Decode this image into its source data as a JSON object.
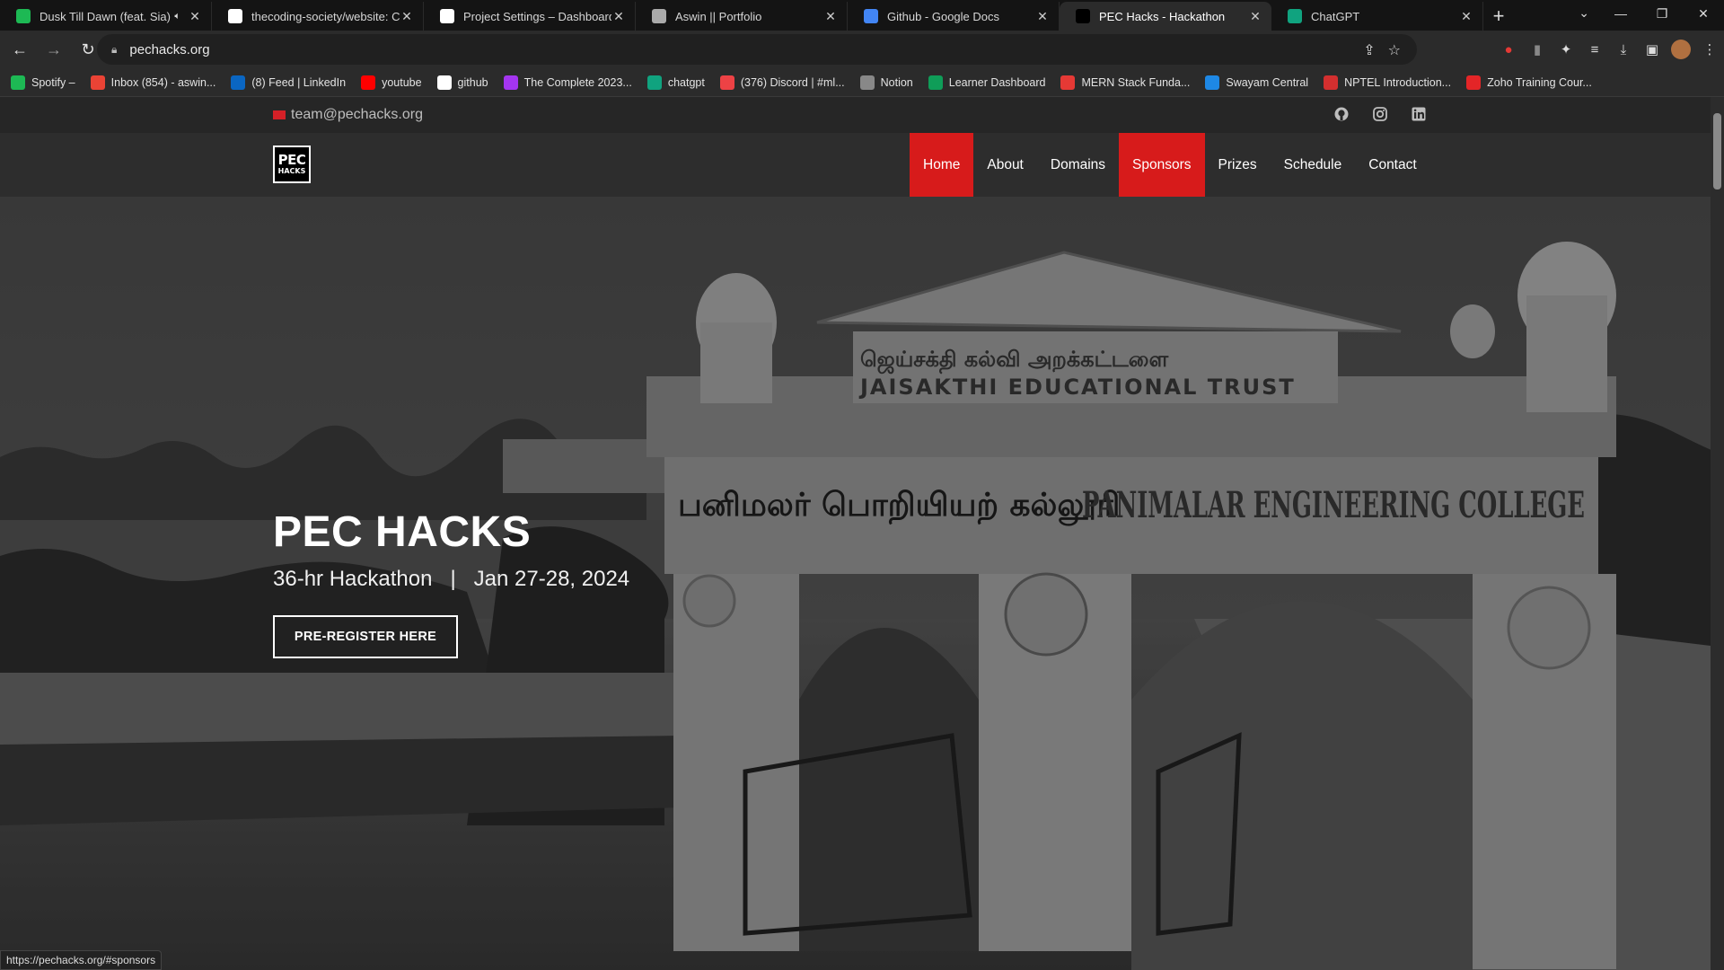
{
  "browser": {
    "tabs": [
      {
        "title": "Dusk Till Dawn (feat. Sia) - R",
        "icon": "spotify-icon",
        "color": "#1db954",
        "muted": true
      },
      {
        "title": "thecoding-society/website: Club",
        "icon": "github-icon",
        "color": "#ffffff"
      },
      {
        "title": "Project Settings – Dashboard – V",
        "icon": "vercel-icon",
        "color": "#ffffff"
      },
      {
        "title": "Aswin || Portfolio",
        "icon": "globe-icon",
        "color": "#aaaaaa"
      },
      {
        "title": "Github - Google Docs",
        "icon": "docs-icon",
        "color": "#4285f4"
      },
      {
        "title": "PEC Hacks - Hackathon",
        "icon": "pec-icon",
        "color": "#000000",
        "active": true
      },
      {
        "title": "ChatGPT",
        "icon": "chatgpt-icon",
        "color": "#10a37f"
      }
    ],
    "url": "pechacks.org",
    "bookmarks": [
      {
        "label": "Spotify –",
        "icon": "spotify-icon",
        "color": "#1db954"
      },
      {
        "label": "Inbox (854) - aswin...",
        "icon": "gmail-icon",
        "color": "#ea4335"
      },
      {
        "label": "(8) Feed | LinkedIn",
        "icon": "linkedin-icon",
        "color": "#0a66c2"
      },
      {
        "label": "youtube",
        "icon": "youtube-icon",
        "color": "#ff0000"
      },
      {
        "label": "github",
        "icon": "github-icon",
        "color": "#ffffff"
      },
      {
        "label": "The Complete 2023...",
        "icon": "udemy-icon",
        "color": "#a435f0"
      },
      {
        "label": "chatgpt",
        "icon": "chatgpt-icon",
        "color": "#10a37f"
      },
      {
        "label": "(376) Discord | #ml...",
        "icon": "discord-icon",
        "color": "#ed4245"
      },
      {
        "label": "Notion",
        "icon": "notion-icon",
        "color": "#888888"
      },
      {
        "label": "Learner Dashboard",
        "icon": "learner-icon",
        "color": "#0f9d58"
      },
      {
        "label": "MERN Stack Funda...",
        "icon": "mern-icon",
        "color": "#e53935"
      },
      {
        "label": "Swayam Central",
        "icon": "swayam-icon",
        "color": "#1e88e5"
      },
      {
        "label": "NPTEL Introduction...",
        "icon": "nptel-icon",
        "color": "#d32f2f"
      },
      {
        "label": "Zoho Training Cour...",
        "icon": "zoho-icon",
        "color": "#e42527"
      }
    ],
    "status_url": "https://pechacks.org/#sponsors"
  },
  "site": {
    "email": "team@pechacks.org",
    "social": [
      "github-icon",
      "instagram-icon",
      "linkedin-icon"
    ],
    "logo": {
      "line1": "PEC",
      "line2": "HACKS"
    },
    "nav": [
      {
        "label": "Home",
        "highlight": true
      },
      {
        "label": "About"
      },
      {
        "label": "Domains"
      },
      {
        "label": "Sponsors",
        "highlight": true
      },
      {
        "label": "Prizes"
      },
      {
        "label": "Schedule"
      },
      {
        "label": "Contact"
      }
    ],
    "hero": {
      "title": "PEC HACKS",
      "subtitle": "36-hr Hackathon   |   Jan 27-28, 2024",
      "button": "PRE-REGISTER HERE",
      "arch_tamil_top": "ஜெய்சக்தி கல்வி அறக்கட்டளை",
      "arch_trust": "JAISAKTHI EDUCATIONAL TRUST",
      "arch_tamil_main": "பனிமலர் பொறியியற் கல்லூரி",
      "arch_college": "PANIMALAR ENGINEERING COLLEGE"
    },
    "accent": "#d71b1b"
  }
}
